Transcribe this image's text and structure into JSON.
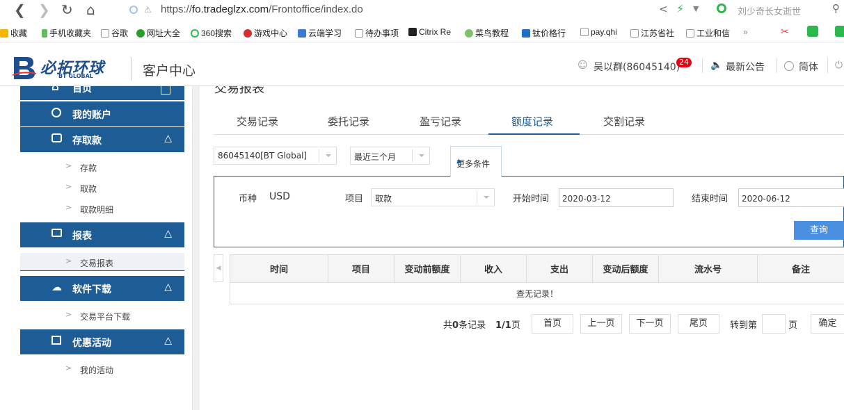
{
  "browser": {
    "url_prefix": "https://",
    "url_domain": "fo.tradeglzx.com",
    "url_path": "/Frontoffice/index.do",
    "search_hint": "刘少奇长女逝世",
    "bookmarks": [
      "收藏",
      "手机收藏夹",
      "谷歌",
      "网址大全",
      "360搜索",
      "游戏中心",
      "云端学习",
      "待办事项",
      "Citrix Re",
      "菜鸟教程",
      "钛价格行",
      "pay.qhi",
      "江苏省社",
      "工业和信"
    ],
    "more_glyph": "»"
  },
  "header": {
    "brand": "必拓环球",
    "brand_sub": "BT GLOBAL",
    "title": "客户中心",
    "user": "吴以群(86045140)",
    "badge": "24",
    "announce": "最新公告",
    "lang": "简体"
  },
  "sidebar": {
    "home": "首页",
    "account": "我的账户",
    "deposit": "存取款",
    "deposit_items": [
      "存款",
      "取款",
      "取款明细"
    ],
    "reports": "报表",
    "report_items": [
      "交易报表"
    ],
    "download": "软件下载",
    "download_items": [
      "交易平台下载"
    ],
    "promo": "优惠活动",
    "promo_items": [
      "我的活动"
    ]
  },
  "main": {
    "page_title": "交易报表",
    "tabs": [
      "交易记录",
      "委托记录",
      "盈亏记录",
      "额度记录",
      "交割记录"
    ],
    "active_tab": "额度记录",
    "account_select": "86045140[BT Global]",
    "period_select": "最近三个月",
    "more_conditions": "更多条件",
    "currency_label": "币种",
    "currency_value": "USD",
    "item_label": "项目",
    "item_value": "取款",
    "start_label": "开始时间",
    "start_value": "2020-03-12",
    "end_label": "结束时间",
    "end_value": "2020-06-12",
    "query_button": "查询",
    "table_headers": [
      "时间",
      "项目",
      "变动前额度",
      "收入",
      "支出",
      "变动后额度",
      "流水号",
      "备注"
    ],
    "empty_text": "查无记录！"
  },
  "pagination": {
    "total_prefix": "共",
    "total_count": "0",
    "total_suffix": "条记录",
    "page_current": "1/1",
    "page_suffix": "页",
    "first": "首页",
    "prev": "上一页",
    "next": "下一页",
    "last": "尾页",
    "goto_label": "转到第",
    "goto_suffix": "页",
    "confirm": "确定"
  },
  "colors": {
    "primary": "#1e5c96",
    "query_button": "#4a8fe0",
    "badge": "#e60012"
  }
}
